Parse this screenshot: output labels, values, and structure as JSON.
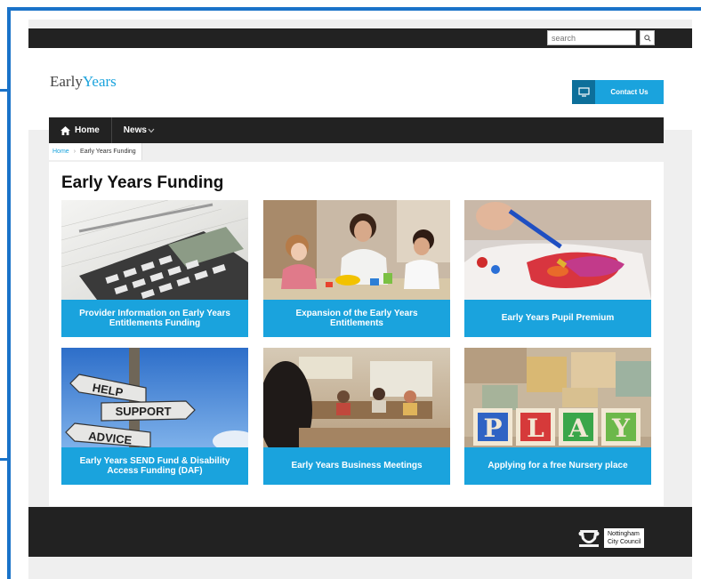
{
  "search": {
    "placeholder": "search",
    "button_icon": "search-icon"
  },
  "site": {
    "logo_part1": "Early",
    "logo_part2": "Years"
  },
  "header": {
    "contact_label": "Contact Us",
    "contact_icon": "monitor-icon"
  },
  "nav": {
    "items": [
      {
        "label": "Home",
        "icon": "home-icon"
      },
      {
        "label": "News",
        "icon": "chevron-down-icon"
      }
    ]
  },
  "breadcrumb": {
    "home": "Home",
    "current": "Early Years Funding"
  },
  "main": {
    "title": "Early Years Funding",
    "tiles": [
      {
        "label": "Provider Information on Early Years Entitlements Funding"
      },
      {
        "label": "Expansion of the Early Years Entitlements"
      },
      {
        "label": "Early Years Pupil Premium"
      },
      {
        "label": "Early Years SEND Fund & Disability Access Funding (DAF)",
        "image_signs": [
          "HELP",
          "SUPPORT",
          "ADVICE"
        ]
      },
      {
        "label": "Early Years Business Meetings"
      },
      {
        "label": "Applying for a free Nursery place",
        "image_blocks": [
          "P",
          "L",
          "A",
          "Y"
        ]
      }
    ]
  },
  "footer": {
    "council_line1": "Nottingham",
    "council_line2": "City Council"
  },
  "colors": {
    "accent": "#1aa3dd",
    "dark": "#222222",
    "frame": "#1a73c9"
  }
}
